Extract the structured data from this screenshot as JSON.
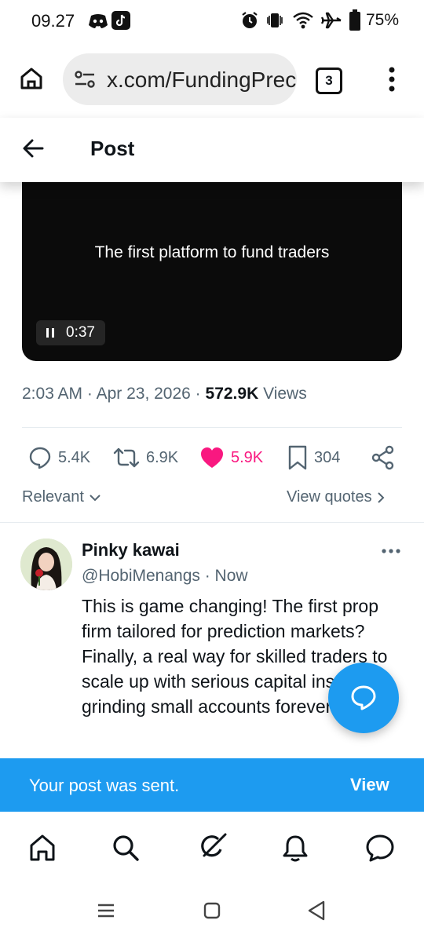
{
  "status_bar": {
    "time": "09.27",
    "battery": "75%",
    "icons": [
      "discord-icon",
      "tiktok-icon",
      "alarm-icon",
      "vibrate-icon",
      "wifi-icon",
      "airplane-icon",
      "battery-icon"
    ]
  },
  "browser": {
    "url": "x.com/FundingPrec",
    "tab_count": "3"
  },
  "header": {
    "title": "Post"
  },
  "video": {
    "caption": "The first platform to fund traders",
    "duration": "0:37"
  },
  "post_meta": {
    "time": "2:03 AM",
    "sep1": " · ",
    "date": "Apr 23, 2026",
    "sep2": " · ",
    "views_count": "572.9K",
    "views_label": " Views"
  },
  "actions": {
    "replies": "5.4K",
    "reposts": "6.9K",
    "likes": "5.9K",
    "bookmarks": "304"
  },
  "sort": {
    "label": "Relevant",
    "view_quotes": "View quotes"
  },
  "reply": {
    "name": "Pinky kawai",
    "handle": "@HobiMenangs · Now",
    "text": "This is game changing! The first prop firm tailored for prediction markets? Finally, a real way for skilled traders to scale up with serious capital instead of grinding small accounts forever. 👍"
  },
  "toast": {
    "message": "Your post was sent.",
    "action": "View"
  },
  "colors": {
    "accent": "#1d9bf0",
    "like": "#f91880",
    "muted": "#536471"
  }
}
